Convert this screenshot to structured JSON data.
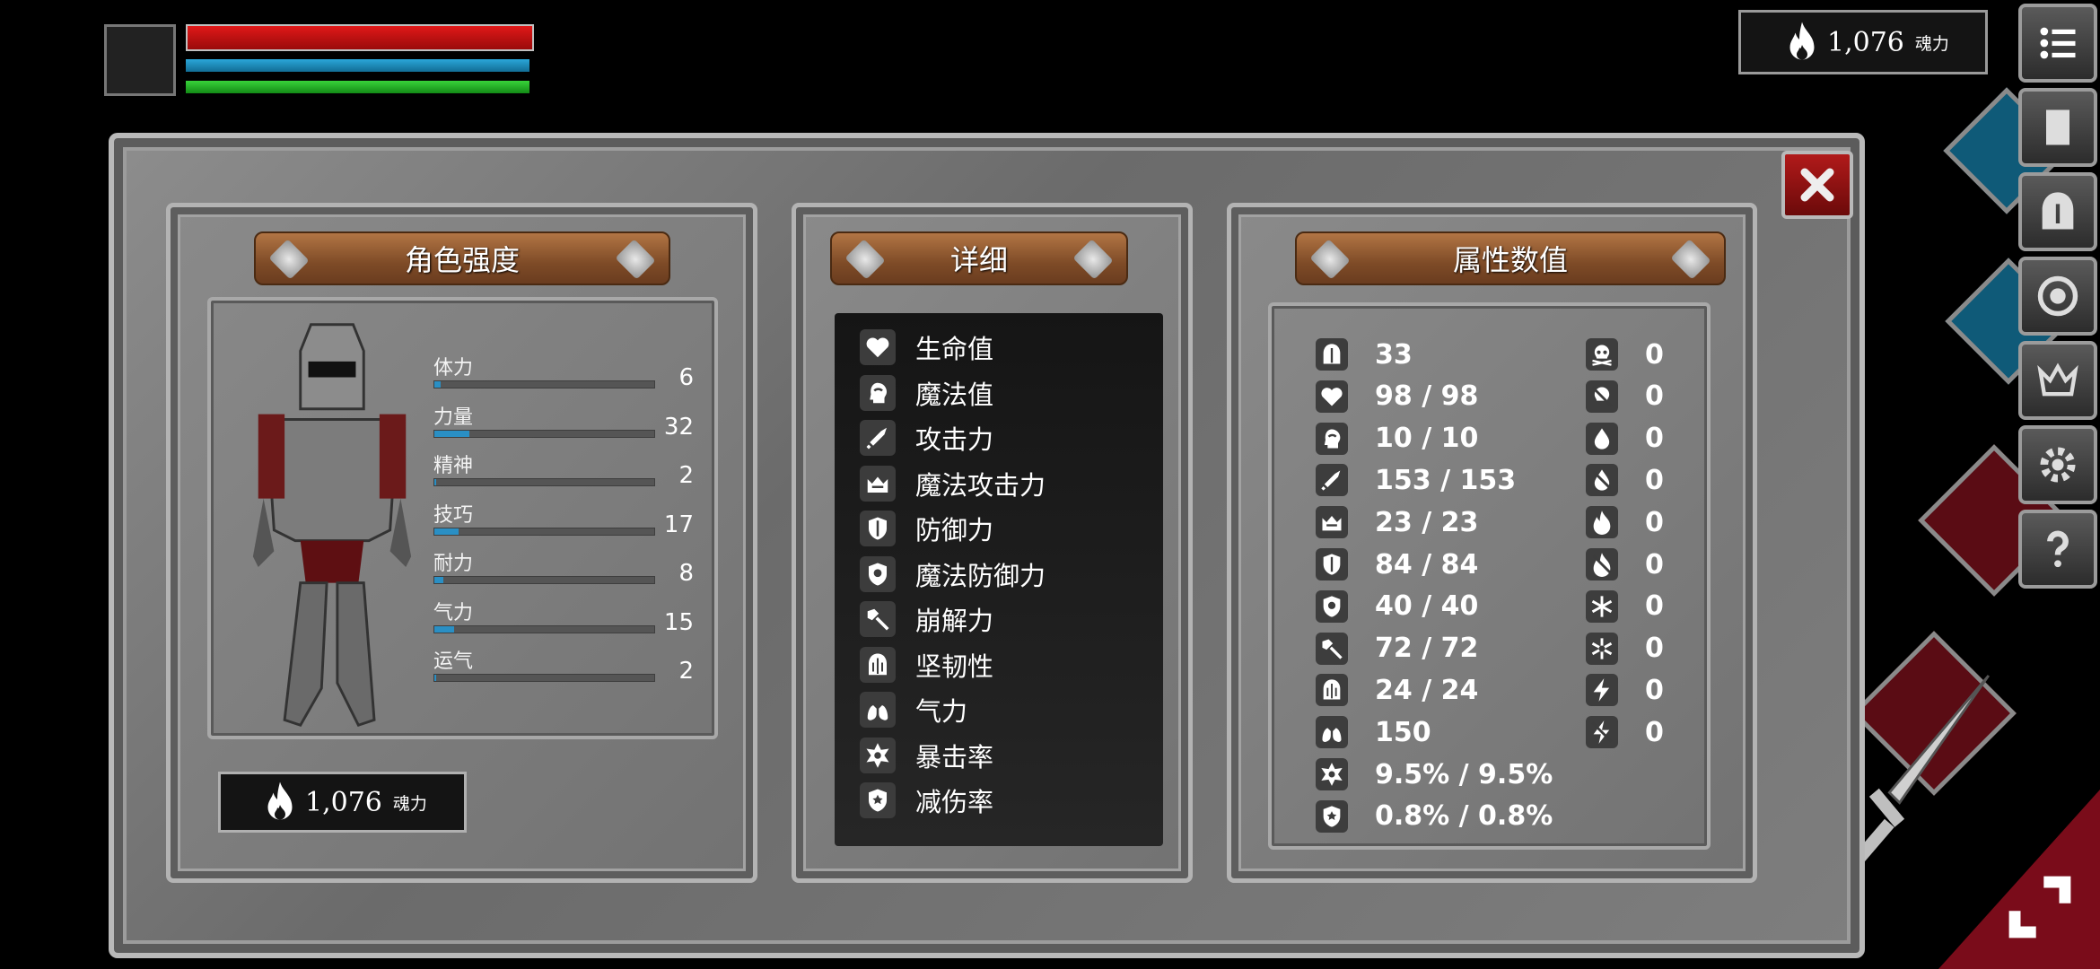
{
  "hud": {
    "bars": [
      {
        "name": "health",
        "fill": 1.0,
        "color": "#d01414"
      },
      {
        "name": "mana",
        "fill": 1.0,
        "color": "#2098cc"
      },
      {
        "name": "stamina",
        "fill": 1.0,
        "color": "#2cc42e"
      }
    ],
    "soul_value": "1,076",
    "soul_unit": "魂力"
  },
  "side_buttons": [
    "menu-icon",
    "character-icon",
    "helmet-icon",
    "emblem-icon",
    "crown-icon",
    "gear-icon",
    "help-icon"
  ],
  "panels": {
    "strength_title": "角色强度",
    "detail_title": "详细",
    "attributes_title": "属性数值"
  },
  "stats": [
    {
      "label": "体力",
      "value": "6",
      "fill": 0.03
    },
    {
      "label": "力量",
      "value": "32",
      "fill": 0.16
    },
    {
      "label": "精神",
      "value": "2",
      "fill": 0.01
    },
    {
      "label": "技巧",
      "value": "17",
      "fill": 0.11
    },
    {
      "label": "耐力",
      "value": "8",
      "fill": 0.04
    },
    {
      "label": "气力",
      "value": "15",
      "fill": 0.09
    },
    {
      "label": "运气",
      "value": "2",
      "fill": 0.01
    }
  ],
  "soul_box": {
    "value": "1,076",
    "unit": "魂力"
  },
  "details": [
    {
      "icon": "heart-icon",
      "label": "生命值"
    },
    {
      "icon": "head-icon",
      "label": "魔法值"
    },
    {
      "icon": "sword-icon",
      "label": "攻击力"
    },
    {
      "icon": "magic-crown-icon",
      "label": "魔法攻击力"
    },
    {
      "icon": "shield-icon",
      "label": "防御力"
    },
    {
      "icon": "magic-shield-icon",
      "label": "魔法防御力"
    },
    {
      "icon": "axe-icon",
      "label": "崩解力"
    },
    {
      "icon": "helm-icon",
      "label": "坚韧性"
    },
    {
      "icon": "lungs-icon",
      "label": "气力"
    },
    {
      "icon": "star-burst-icon",
      "label": "暴击率"
    },
    {
      "icon": "badge-icon",
      "label": "减伤率"
    }
  ],
  "attributes_left": [
    {
      "icon": "helmet-icon",
      "value": "33"
    },
    {
      "icon": "heart-icon",
      "value": "98 / 98"
    },
    {
      "icon": "head-icon",
      "value": "10 / 10"
    },
    {
      "icon": "sword-icon",
      "value": "153 / 153"
    },
    {
      "icon": "magic-crown-icon",
      "value": "23 / 23"
    },
    {
      "icon": "shield-icon",
      "value": "84 / 84"
    },
    {
      "icon": "magic-shield-icon",
      "value": "40 / 40"
    },
    {
      "icon": "axe-icon",
      "value": "72 / 72"
    },
    {
      "icon": "helm-icon",
      "value": "24 / 24"
    },
    {
      "icon": "lungs-icon",
      "value": "150"
    },
    {
      "icon": "star-burst-icon",
      "value": "9.5% / 9.5%"
    },
    {
      "icon": "badge-icon",
      "value": "0.8% / 0.8%"
    }
  ],
  "attributes_right": [
    {
      "icon": "skull-icon",
      "value": "0"
    },
    {
      "icon": "skull-resist-icon",
      "value": "0"
    },
    {
      "icon": "blood-drop-icon",
      "value": "0"
    },
    {
      "icon": "blood-resist-icon",
      "value": "0"
    },
    {
      "icon": "fire-icon",
      "value": "0"
    },
    {
      "icon": "fire-resist-icon",
      "value": "0"
    },
    {
      "icon": "frost-icon",
      "value": "0"
    },
    {
      "icon": "frost-resist-icon",
      "value": "0"
    },
    {
      "icon": "lightning-icon",
      "value": "0"
    },
    {
      "icon": "lightning-resist-icon",
      "value": "0"
    }
  ]
}
